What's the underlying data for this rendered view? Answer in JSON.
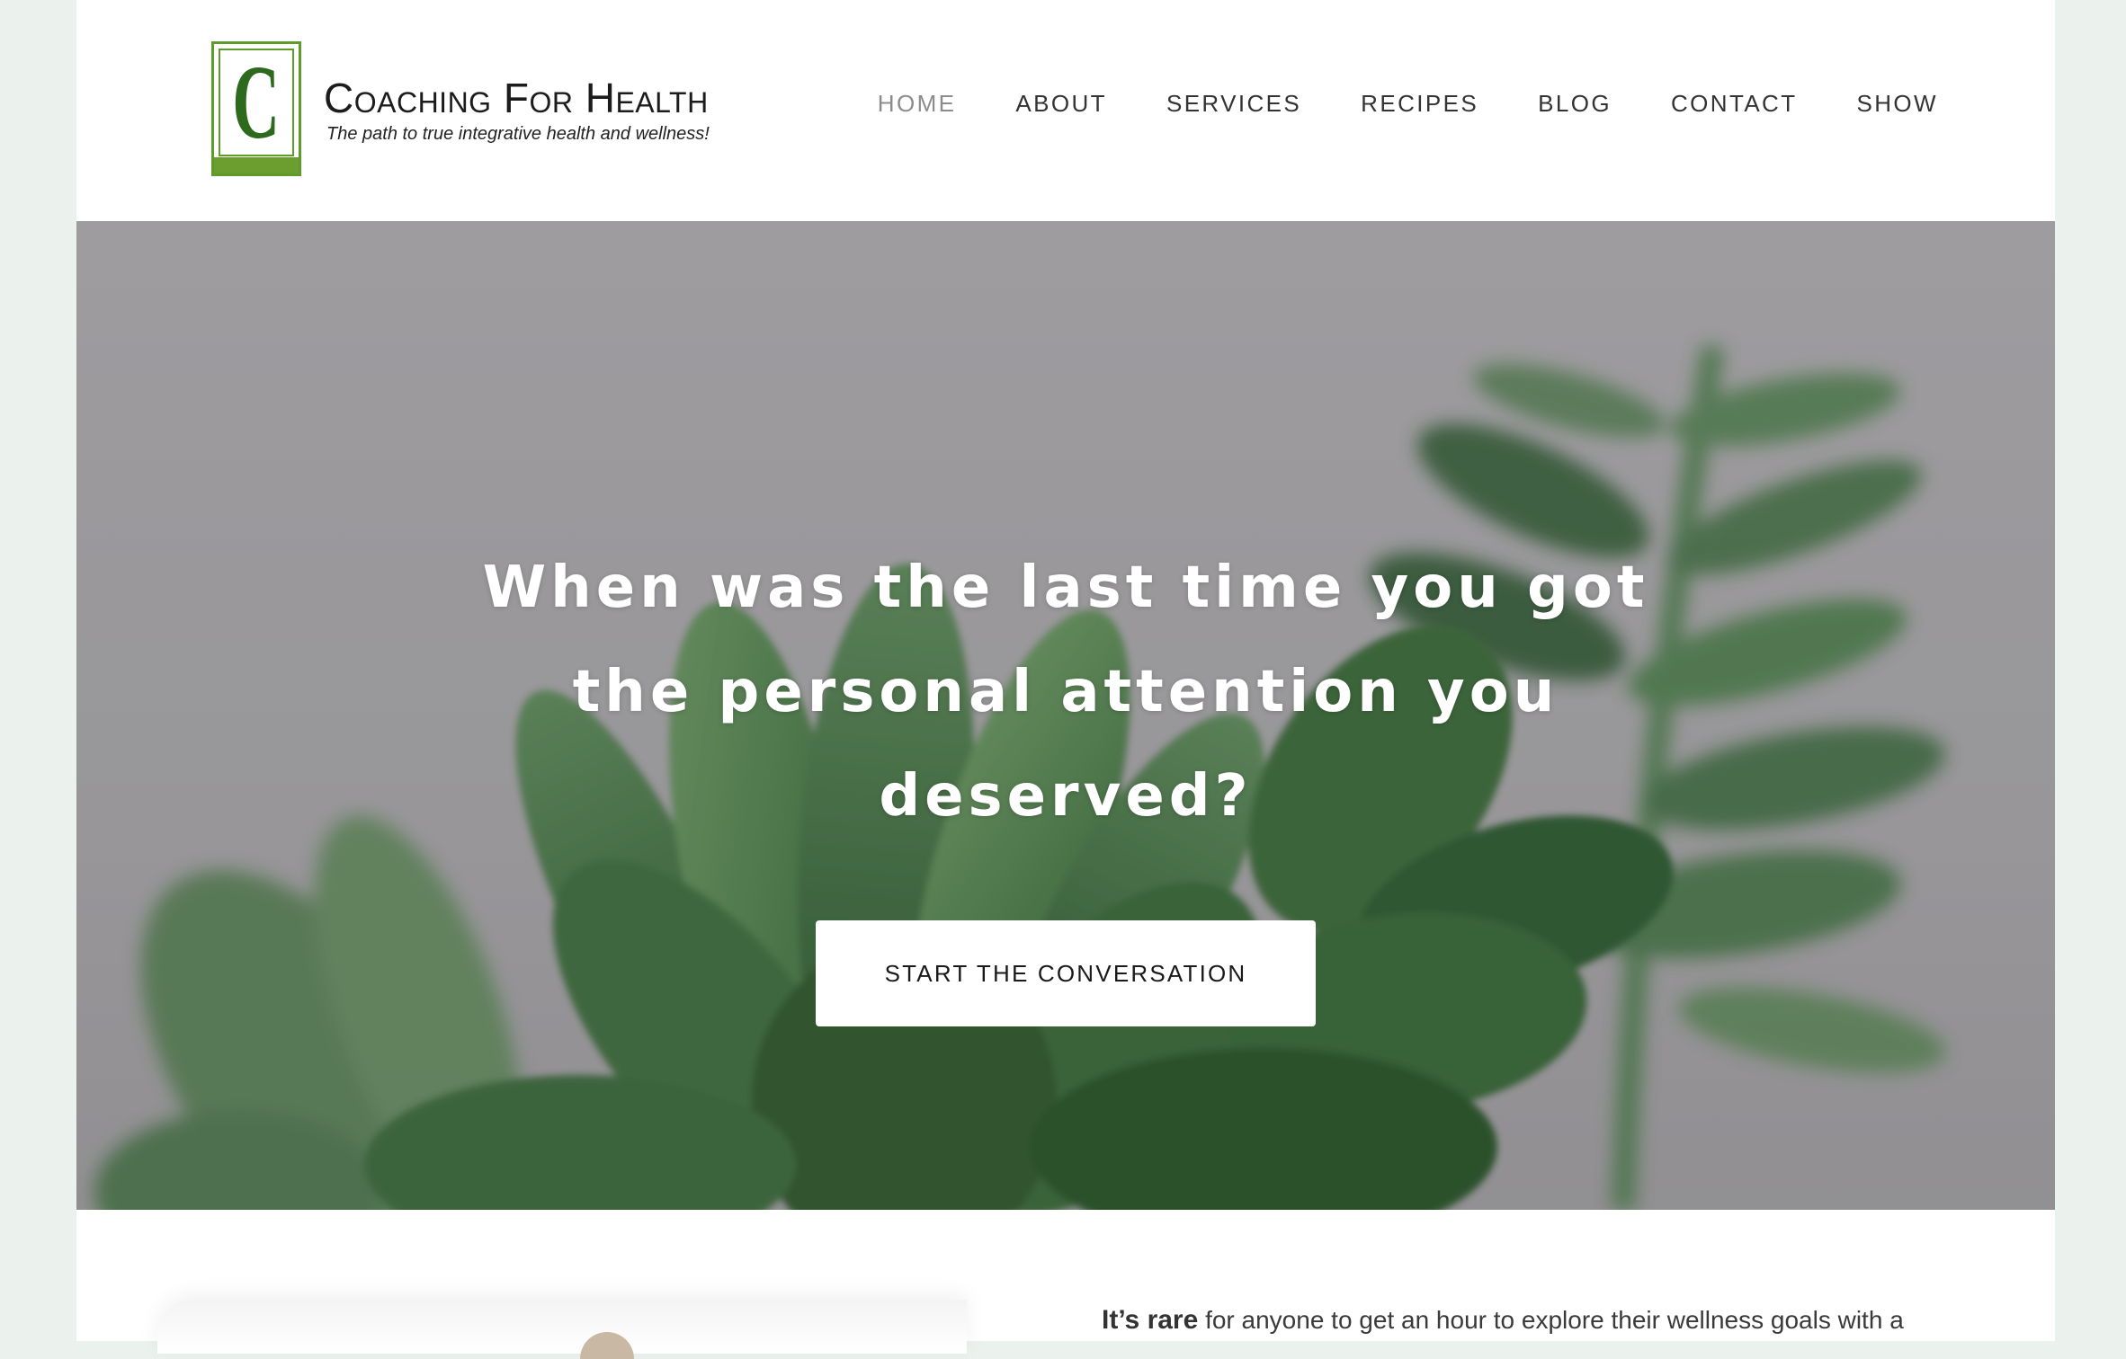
{
  "brand": {
    "logo_letter": "C",
    "name": "Coaching For Health",
    "tagline": "The path to true integrative health and wellness!",
    "accent_color": "#5e9c2a"
  },
  "nav": {
    "items": [
      {
        "label": "HOME",
        "active": true
      },
      {
        "label": "ABOUT",
        "active": false
      },
      {
        "label": "SERVICES",
        "active": false
      },
      {
        "label": "RECIPES",
        "active": false
      },
      {
        "label": "BLOG",
        "active": false
      },
      {
        "label": "CONTACT",
        "active": false
      },
      {
        "label": "SHOW",
        "active": false
      }
    ]
  },
  "hero": {
    "headline": "When was the last time you got the personal attention you deserved?",
    "cta_label": "START THE CONVERSATION",
    "background_image": "succulent-plant"
  },
  "intro": {
    "lead": "It’s rare",
    "text": " for anyone to get an hour to explore their wellness goals with a"
  }
}
